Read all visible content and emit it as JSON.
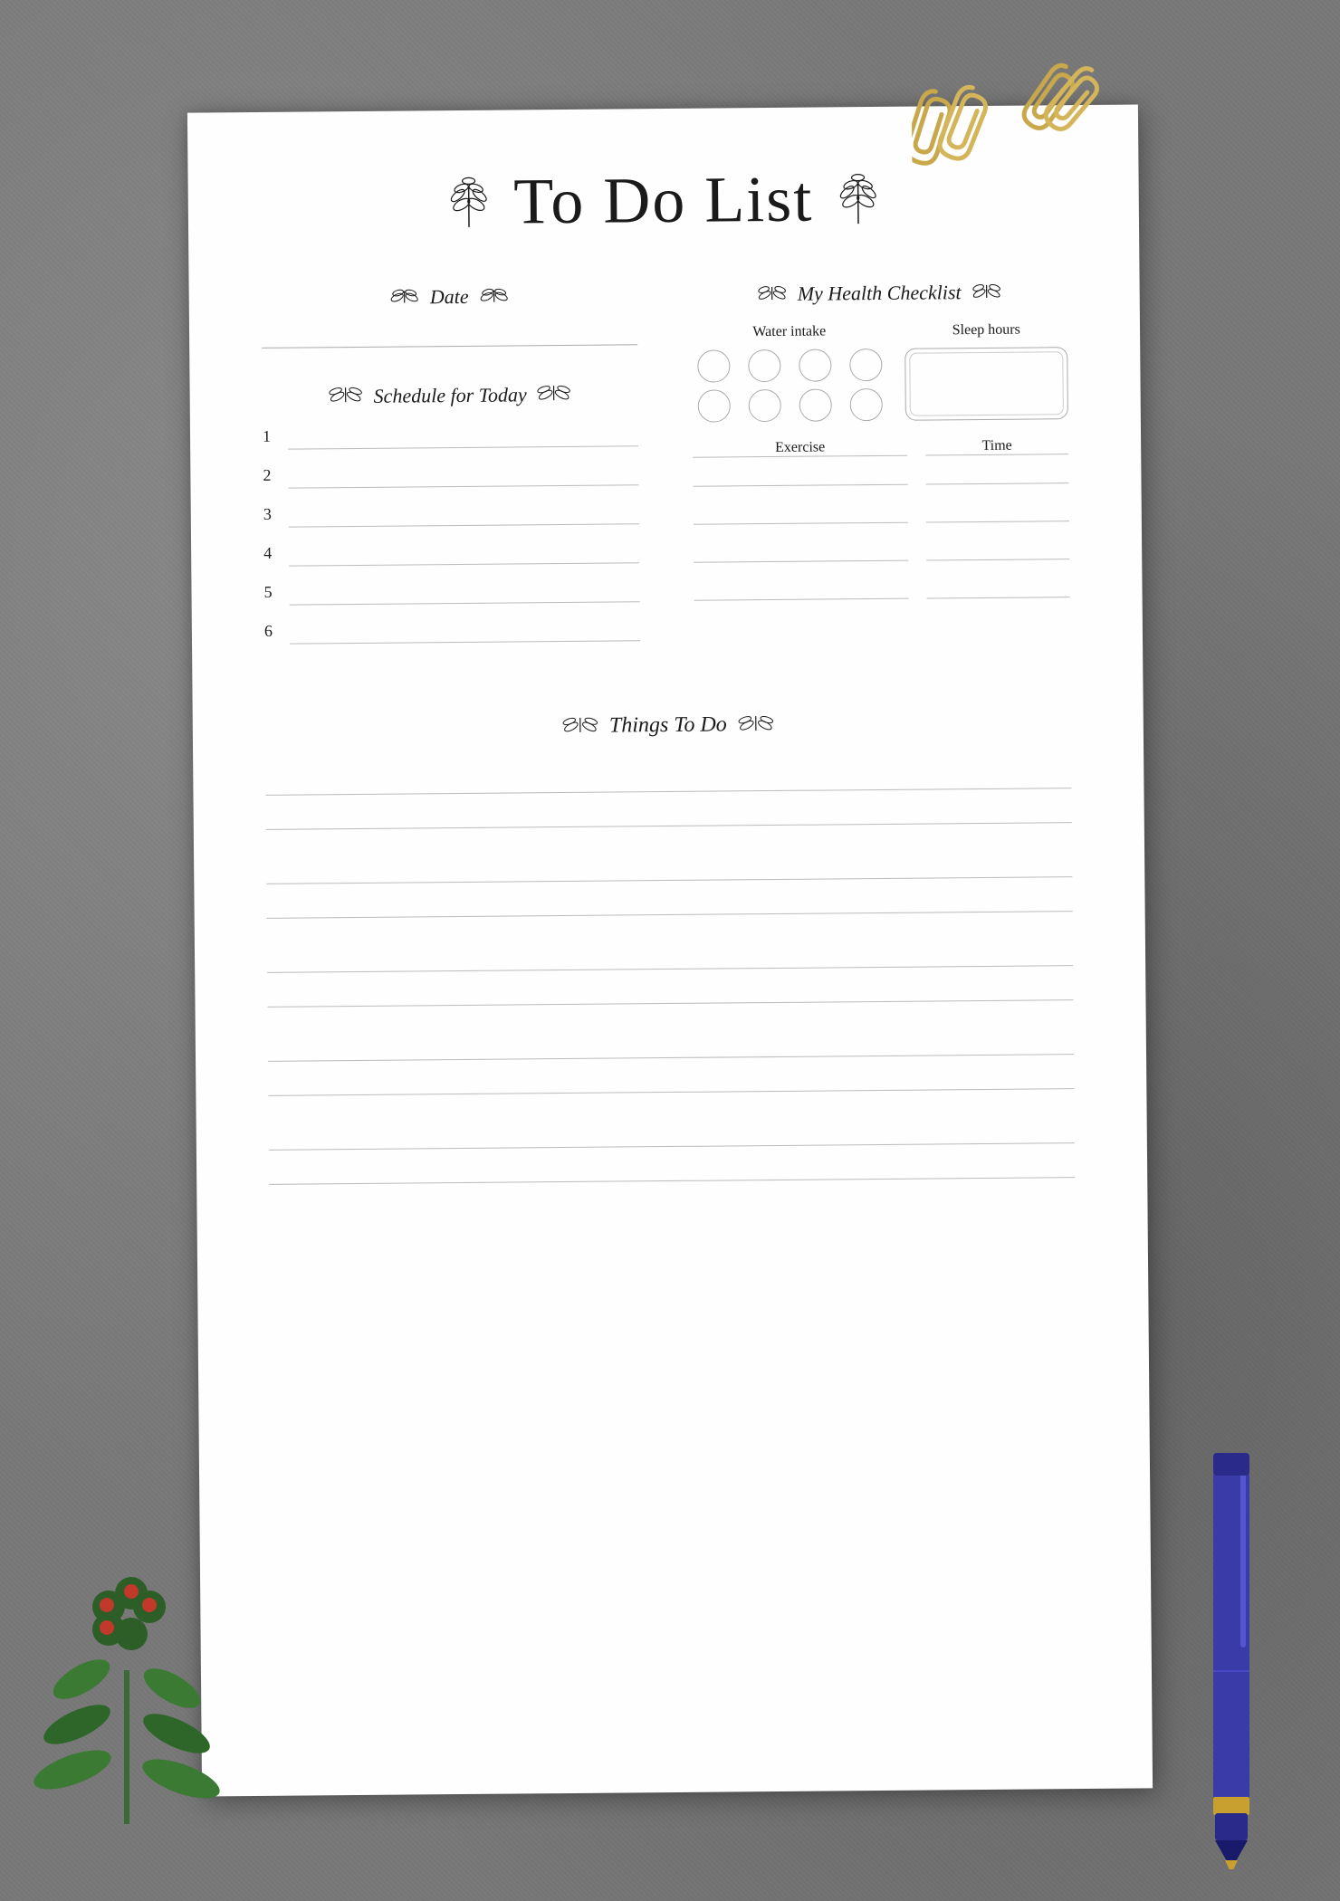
{
  "page": {
    "background_color": "#7a7a7a"
  },
  "title": {
    "text": "To Do List",
    "leaf_left": "🌿",
    "leaf_right": "🌿"
  },
  "date_section": {
    "label": "Date",
    "placeholder": ""
  },
  "schedule_section": {
    "label": "Schedule for Today",
    "items": [
      {
        "number": "1"
      },
      {
        "number": "2"
      },
      {
        "number": "3"
      },
      {
        "number": "4"
      },
      {
        "number": "5"
      },
      {
        "number": "6"
      }
    ]
  },
  "health_section": {
    "label": "My Health Checklist",
    "water_label": "Water intake",
    "sleep_label": "Sleep hours",
    "water_circles": 8,
    "exercise_label": "Exercise",
    "time_label": "Time",
    "exercise_rows": 4
  },
  "things_section": {
    "label": "Things To Do",
    "line_pairs": 5
  }
}
